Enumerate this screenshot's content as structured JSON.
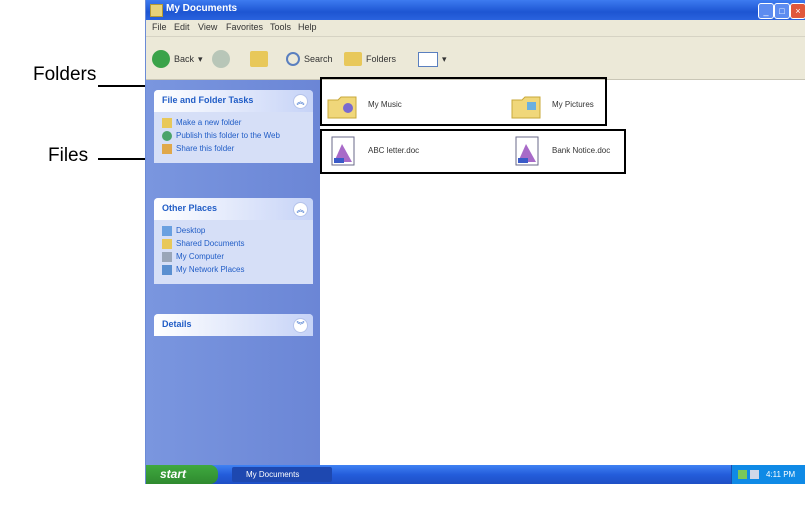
{
  "callouts": {
    "folders": "Folders",
    "files": "Files"
  },
  "window": {
    "title": "My Documents",
    "title_buttons": {
      "minimize": "_",
      "maximize": "□",
      "close": "×"
    }
  },
  "menu": [
    "File",
    "Edit",
    "View",
    "Favorites",
    "Tools",
    "Help"
  ],
  "toolbar": {
    "back": "Back",
    "search": "Search",
    "folders": "Folders"
  },
  "sidebar": {
    "file_folder_tasks": {
      "title": "File and Folder Tasks",
      "links": [
        "Make a new folder",
        "Publish this folder to the Web",
        "Share this folder"
      ]
    },
    "other_places": {
      "title": "Other Places",
      "links": [
        "Desktop",
        "Shared Documents",
        "My Computer",
        "My Network Places"
      ]
    },
    "details": {
      "title": "Details"
    }
  },
  "content": {
    "folders": [
      {
        "label": "My Music",
        "icon": "music-folder-icon"
      },
      {
        "label": "My Pictures",
        "icon": "pictures-folder-icon"
      }
    ],
    "files": [
      {
        "label": "ABC letter.doc",
        "icon": "document-icon"
      },
      {
        "label": "Bank Notice.doc",
        "icon": "document-icon"
      }
    ]
  },
  "taskbar": {
    "start": "start",
    "task": "My Documents",
    "clock": "4:11 PM"
  },
  "colors": {
    "titlebar": "#2a63de",
    "sidebar": "#7a96df",
    "start": "#2f8a2f",
    "link": "#215dc6"
  }
}
